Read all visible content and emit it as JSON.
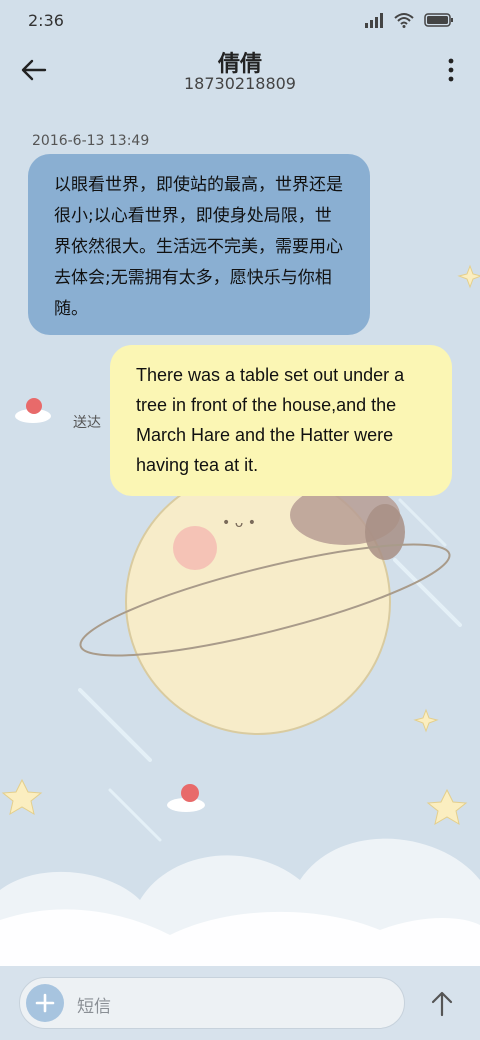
{
  "status_bar": {
    "time": "2:36",
    "icons": [
      "signal-icon",
      "wifi-icon",
      "battery-icon"
    ]
  },
  "header": {
    "title": "倩倩",
    "phone": "18730218809",
    "icons": [
      "back-arrow-icon",
      "more-vertical-icon"
    ]
  },
  "conversation": {
    "timestamp": "2016-6-13 13:49",
    "messages": [
      {
        "direction": "incoming",
        "text": "以眼看世界，即使站的最高，世界还是很小;以心看世界，即使身处局限，世界依然很大。生活远不完美，需要用心去体会;无需拥有太多，愿快乐与你相随。"
      },
      {
        "direction": "outgoing",
        "text": "There was a table set out under a tree in front of the house,and the March Hare and the Hatter were having tea at it.",
        "status": "送达"
      }
    ]
  },
  "composer": {
    "placeholder": "短信",
    "icons": [
      "add-icon",
      "send-arrow-icon"
    ]
  },
  "colors": {
    "background": "#d2dfea",
    "incoming_bubble": "#8aafd2",
    "outgoing_bubble": "#fbf6b4"
  }
}
